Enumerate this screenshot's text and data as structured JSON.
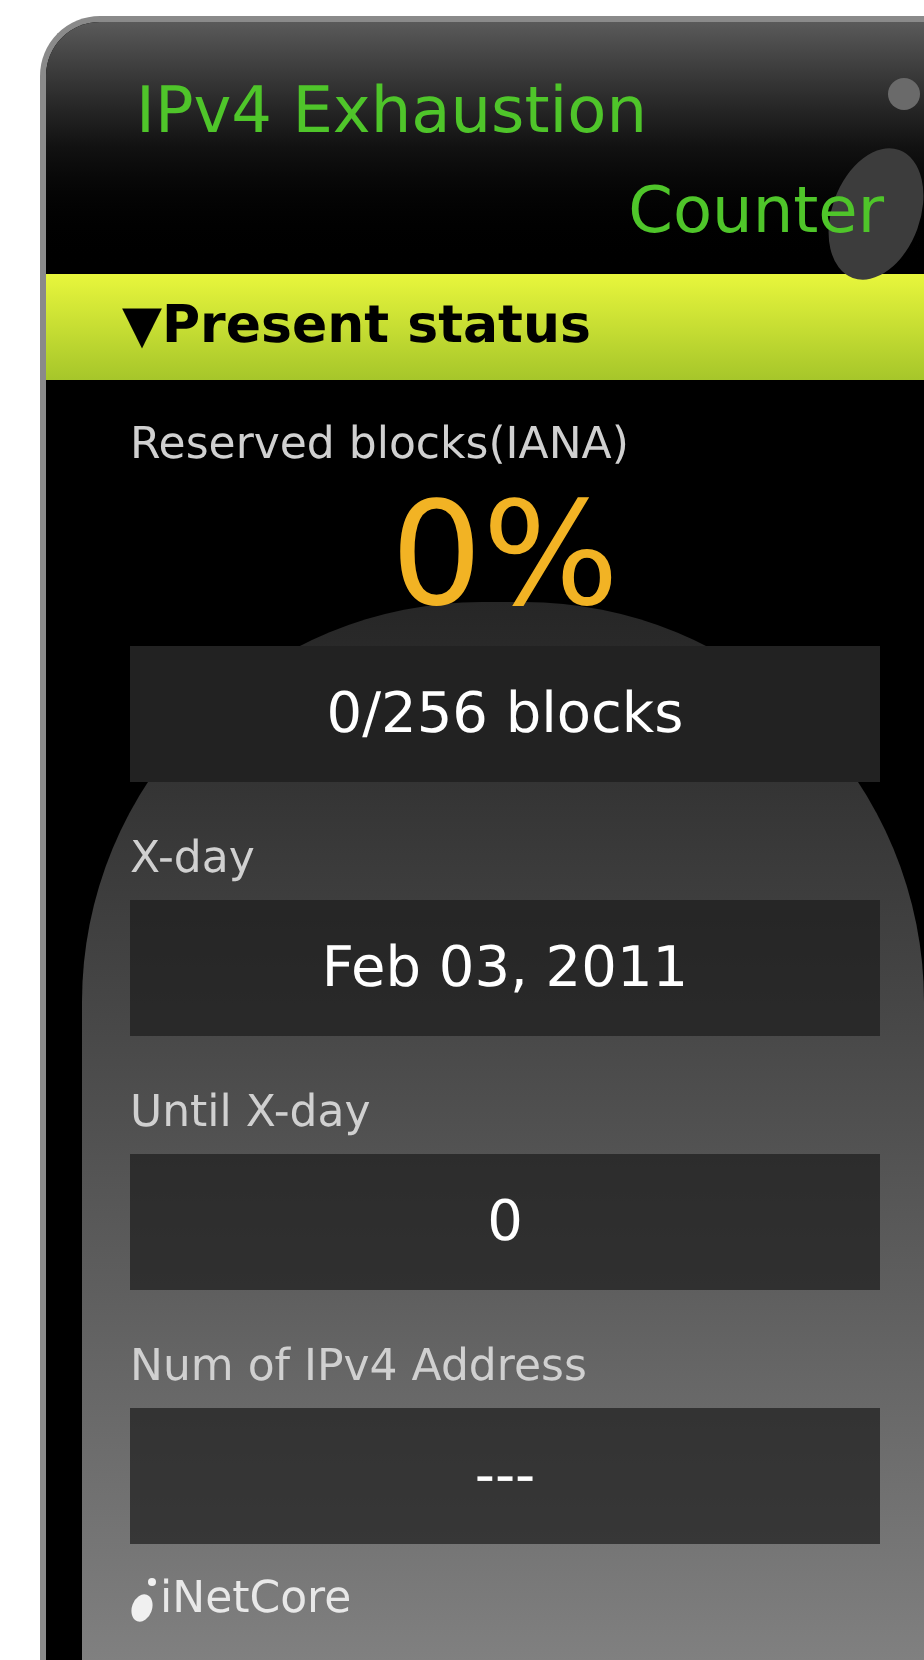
{
  "title": {
    "line_1": "IPv4 Exhaustion",
    "line_2": "Counter"
  },
  "section": {
    "label": "▼Present status"
  },
  "rows": [
    {
      "kind": "percent",
      "label": "Reserved blocks(IANA)",
      "big_value": "0%",
      "value": "0/256 blocks"
    },
    {
      "kind": "plain",
      "label": "X-day",
      "value": "Feb 03, 2011"
    },
    {
      "kind": "plain",
      "label": "Until X-day",
      "value": "0"
    },
    {
      "kind": "plain",
      "label": "Num of IPv4 Address",
      "value": "---"
    }
  ],
  "footer": {
    "brand": "iNetCore"
  }
}
